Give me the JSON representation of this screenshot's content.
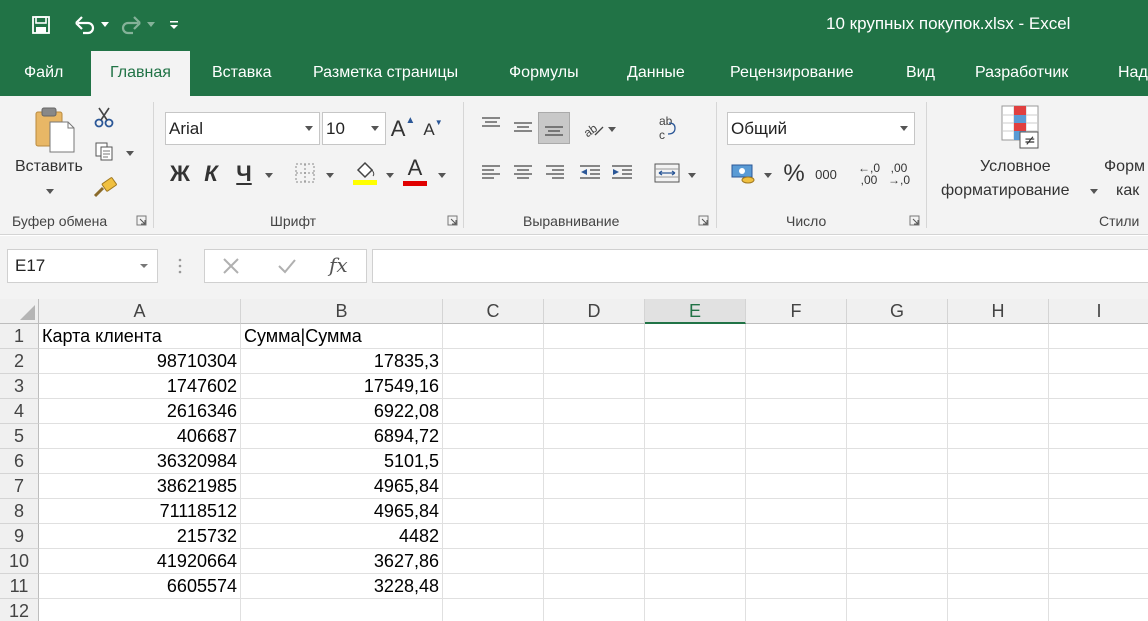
{
  "window": {
    "title": "10 крупных покупок.xlsx  -  Excel"
  },
  "colors": {
    "brand": "#217346",
    "font_underline_yellow": "#ffff00",
    "font_color_red": "#e00000"
  },
  "tabs": [
    {
      "label": "Файл",
      "active": false
    },
    {
      "label": "Главная",
      "active": true
    },
    {
      "label": "Вставка",
      "active": false
    },
    {
      "label": "Разметка страницы",
      "active": false
    },
    {
      "label": "Формулы",
      "active": false
    },
    {
      "label": "Данные",
      "active": false
    },
    {
      "label": "Рецензирование",
      "active": false
    },
    {
      "label": "Вид",
      "active": false
    },
    {
      "label": "Разработчик",
      "active": false
    },
    {
      "label": "Над",
      "active": false
    }
  ],
  "ribbon": {
    "clipboard": {
      "paste_label": "Вставить",
      "group_label": "Буфер обмена"
    },
    "font": {
      "font_name": "Arial",
      "font_size": "10",
      "bold": "Ж",
      "italic": "К",
      "underline": "Ч",
      "group_label": "Шрифт"
    },
    "alignment": {
      "group_label": "Выравнивание"
    },
    "number": {
      "format": "Общий",
      "percent": "%",
      "thousands": "000",
      "inc_decimal_top": "←,0",
      "inc_decimal_bottom": ",00",
      "dec_decimal_top": ",00",
      "dec_decimal_bottom": "→,0",
      "group_label": "Число"
    },
    "styles": {
      "cond_format_line1": "Условное",
      "cond_format_line2": "форматирование",
      "format_table_line1": "Форм",
      "format_table_line2": "как",
      "group_label": "Стили"
    }
  },
  "formula_bar": {
    "name_box": "E17",
    "fx": "fx",
    "formula": ""
  },
  "sheet": {
    "columns": [
      "A",
      "B",
      "C",
      "D",
      "E",
      "F",
      "G",
      "H",
      "I"
    ],
    "selected_column": "E",
    "rows": [
      "1",
      "2",
      "3",
      "4",
      "5",
      "6",
      "7",
      "8",
      "9",
      "10",
      "11",
      "12"
    ],
    "header_row": {
      "a": "Карта клиента",
      "b": "Сумма|Сумма"
    },
    "data": [
      {
        "a": "98710304",
        "b": "17835,3"
      },
      {
        "a": "1747602",
        "b": "17549,16"
      },
      {
        "a": "2616346",
        "b": "6922,08"
      },
      {
        "a": "406687",
        "b": "6894,72"
      },
      {
        "a": "36320984",
        "b": "5101,5"
      },
      {
        "a": "38621985",
        "b": "4965,84"
      },
      {
        "a": "71118512",
        "b": "4965,84"
      },
      {
        "a": "215732",
        "b": "4482"
      },
      {
        "a": "41920664",
        "b": "3627,86"
      },
      {
        "a": "6605574",
        "b": "3228,48"
      }
    ]
  }
}
